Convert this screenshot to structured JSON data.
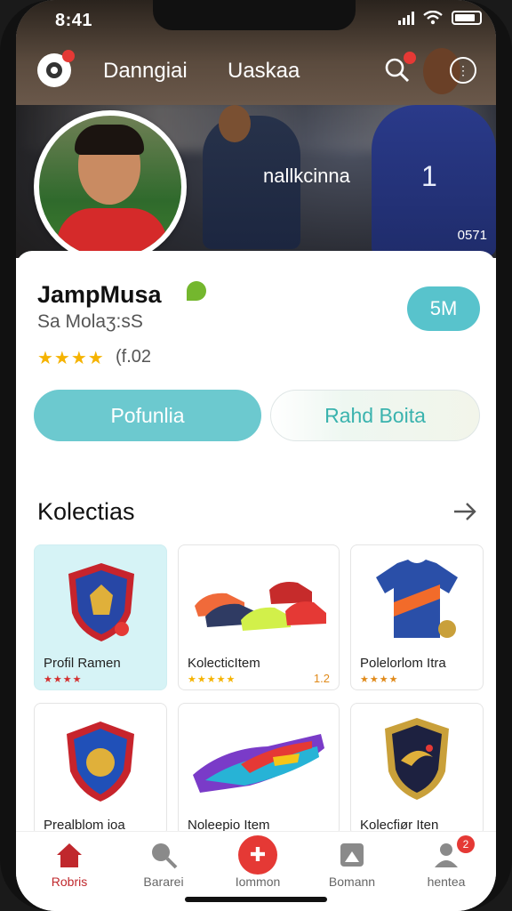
{
  "status_bar": {
    "time": "8:41"
  },
  "header": {
    "nav_links": [
      "Danngiai",
      "Uaskaa"
    ],
    "icons": [
      "app-logo-icon",
      "search-icon",
      "menu-icon"
    ]
  },
  "banner": {
    "player_name": "nallkcinna",
    "count": "0571",
    "jersey_number": "1"
  },
  "profile": {
    "name": "JampMusa",
    "subtitle": "Sa Molaʒ:sS",
    "rating_value": "(f.02",
    "stars": "★★★★",
    "followers": "5M"
  },
  "actions": {
    "primary_label": "Pofunlia",
    "secondary_label": "Rahd Boita"
  },
  "section": {
    "title": "Kolectias",
    "arrow_icon": "arrow-right-icon"
  },
  "collections": [
    {
      "label": "Profil Ramen",
      "stars": "★★★★",
      "meta": "",
      "featured": true
    },
    {
      "label": "KolecticItem",
      "stars": "★★★★★",
      "meta": "1.2",
      "featured": false
    },
    {
      "label": "Polelorlom Itra",
      "stars": "★★★★",
      "meta": "",
      "featured": false
    },
    {
      "label": "Prealblom ioa",
      "stars": "",
      "meta": "",
      "featured": false
    },
    {
      "label": "Noleepio Item",
      "stars": "",
      "meta": "",
      "featured": false
    },
    {
      "label": "Kolecfiør Iten",
      "stars": "",
      "meta": "",
      "featured": false
    }
  ],
  "tabbar": {
    "items": [
      {
        "label": "Robris",
        "icon": "home-icon",
        "active": true
      },
      {
        "label": "Bararei",
        "icon": "search-icon",
        "active": false
      },
      {
        "label": "Iommon",
        "icon": "add-icon",
        "active": false
      },
      {
        "label": "Bomann",
        "icon": "collection-icon",
        "active": false
      },
      {
        "label": "hentea",
        "icon": "profile-icon",
        "active": false,
        "badge": "2"
      }
    ]
  },
  "colors": {
    "accent": "#58c3cc",
    "brand_red": "#e53935",
    "star": "#f5b301"
  }
}
